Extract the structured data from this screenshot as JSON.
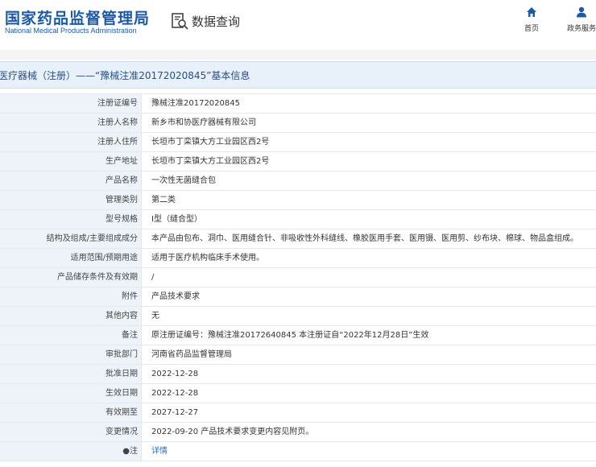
{
  "header": {
    "logo_cn": "国家药品监督管理局",
    "logo_en": "National Medical Products Administration",
    "query_label": "数据查询",
    "nav": [
      {
        "label": "首页",
        "icon": "home-icon"
      },
      {
        "label": "政务服务",
        "icon": "user-icon"
      }
    ]
  },
  "title": "医疗器械（注册）——“豫械注准20172020845”基本信息",
  "rows": [
    {
      "label": "注册证编号",
      "value": "豫械注准20172020845"
    },
    {
      "label": "注册人名称",
      "value": "新乡市和协医疗器械有限公司"
    },
    {
      "label": "注册人住所",
      "value": "长垣市丁栾镇大方工业园区西2号"
    },
    {
      "label": "生产地址",
      "value": "长垣市丁栾镇大方工业园区西2号"
    },
    {
      "label": "产品名称",
      "value": "一次性无菌缝合包"
    },
    {
      "label": "管理类别",
      "value": "第二类"
    },
    {
      "label": "型号规格",
      "value": "Ⅰ型（缝合型）"
    },
    {
      "label": "结构及组成/主要组成成分",
      "value": "本产品由包布、洞巾、医用缝合针、非吸收性外科缝线、橡胶医用手套、医用镊、医用剪、纱布块、棉球、物品盒组成。"
    },
    {
      "label": "适用范围/预期用途",
      "value": "适用于医疗机构临床手术使用。"
    },
    {
      "label": "产品储存条件及有效期",
      "value": "/"
    },
    {
      "label": "附件",
      "value": "产品技术要求"
    },
    {
      "label": "其他内容",
      "value": "无"
    },
    {
      "label": "备注",
      "value": "原注册证编号：豫械注准20172640845 本注册证自“2022年12月28日”生效"
    },
    {
      "label": "审批部门",
      "value": "河南省药品监督管理局"
    },
    {
      "label": "批准日期",
      "value": "2022-12-28"
    },
    {
      "label": "生效日期",
      "value": "2022-12-28"
    },
    {
      "label": "有效期至",
      "value": "2027-12-27"
    },
    {
      "label": "变更情况",
      "value": "2022-09-20 产品技术要求变更内容见附页。"
    },
    {
      "label": "●注",
      "value": "详情"
    }
  ],
  "colors": {
    "brand_blue": "#1d5aa6",
    "link_blue": "#2b6fc0",
    "title_bar_bg": "#e8f0fa",
    "label_bg": "#eef3f9"
  }
}
